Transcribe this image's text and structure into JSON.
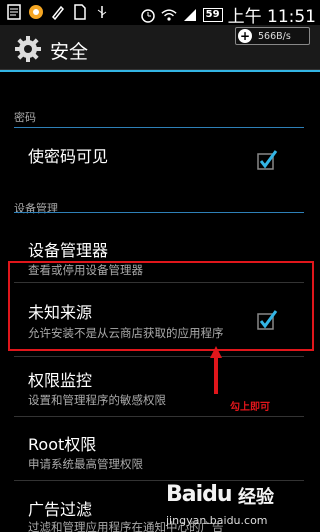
{
  "status_bar": {
    "battery": "59",
    "time": "上午 11:51"
  },
  "action_bar": {
    "title": "安全",
    "net_speed": "566B/s"
  },
  "sections": {
    "password": "密码",
    "device_admin": "设备管理"
  },
  "items": {
    "show_password": {
      "title": "使密码可见",
      "checked": true
    },
    "device_admins": {
      "title": "设备管理器",
      "subtitle": "查看或停用设备管理器"
    },
    "unknown_sources": {
      "title": "未知来源",
      "subtitle": "允许安装不是从云商店获取的应用程序",
      "checked": true
    },
    "permission_monitor": {
      "title": "权限监控",
      "subtitle": "设置和管理程序的敏感权限"
    },
    "root": {
      "title": "Root权限",
      "subtitle": "申请系统最高管理权限"
    },
    "ad_filter": {
      "title": "广告过滤",
      "subtitle": "过滤和管理应用程序在通知中心的广告"
    }
  },
  "annotation": "勾上即可",
  "watermark": {
    "brand": "Baidu",
    "cn": "经验",
    "url": "jingyan.baidu.com"
  },
  "colors": {
    "accent": "#33b5e5",
    "highlight": "#e0161b"
  }
}
